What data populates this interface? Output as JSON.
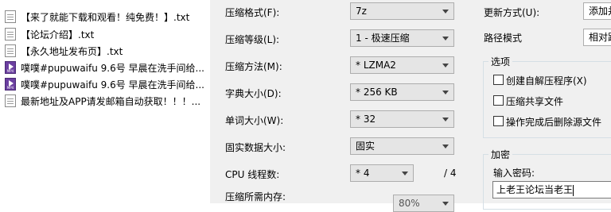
{
  "files": [
    {
      "name": "【来了就能下载和观看！纯免费！】.txt",
      "icon": "txt-file-icon"
    },
    {
      "name": "【论坛介绍】.txt",
      "icon": "txt-file-icon"
    },
    {
      "name": "【永久地址发布页】.txt",
      "icon": "txt-file-icon"
    },
    {
      "name": "噗噗#pupuwaifu 9.6号 早晨在洗手间给...",
      "icon": "mp4-file-icon"
    },
    {
      "name": "噗噗#pupuwaifu 9.6号 早晨在洗手间给...",
      "icon": "mp4-file-icon"
    },
    {
      "name": "最新地址及APP请发邮箱自动获取！！！...",
      "icon": "txt-file-icon"
    }
  ],
  "settings": {
    "archive_format": {
      "label": "压缩格式(F):",
      "value": "7z"
    },
    "compression_level": {
      "label": "压缩等级(L):",
      "value": "1 - 极速压缩"
    },
    "compression_method": {
      "label": "压缩方法(M):",
      "value": "* LZMA2"
    },
    "dictionary_size": {
      "label": "字典大小(D):",
      "value": "* 256 KB"
    },
    "word_size": {
      "label": "单词大小(W):",
      "value": "* 32"
    },
    "solid_block_size": {
      "label": "固实数据大小:",
      "value": "固实"
    },
    "cpu_threads": {
      "label": "CPU 线程数:",
      "value": "* 4",
      "max": "/ 4"
    },
    "memory_usage": {
      "label": "压缩所需内存:",
      "value": "80%"
    }
  },
  "right": {
    "update_mode": {
      "label": "更新方式(U):",
      "value": "添加并"
    },
    "path_mode": {
      "label": "路径模式",
      "value": "相对路"
    }
  },
  "options": {
    "title": "选项",
    "create_sfx": "创建自解压程序(X)",
    "compress_shared": "压缩共享文件",
    "delete_after": "操作完成后删除源文件"
  },
  "encryption": {
    "title": "加密",
    "password_label": "输入密码:",
    "password_value": "上老王论坛当老王"
  }
}
